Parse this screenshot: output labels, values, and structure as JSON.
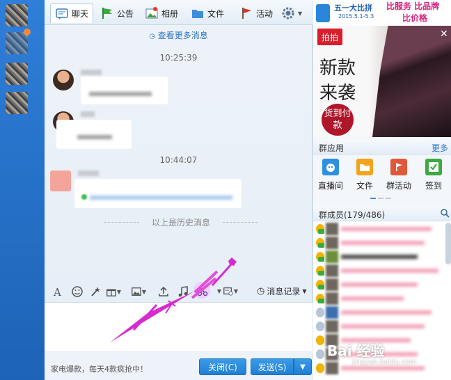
{
  "tabs": [
    {
      "label": "聊天",
      "icon": "chat-icon",
      "active": true
    },
    {
      "label": "公告",
      "icon": "flag-icon"
    },
    {
      "label": "相册",
      "icon": "photo-icon"
    },
    {
      "label": "文件",
      "icon": "folder-icon"
    },
    {
      "label": "活动",
      "icon": "red-flag-icon"
    }
  ],
  "chat": {
    "more_messages": "查看更多消息",
    "times": [
      "10:25:39",
      "10:44:07"
    ],
    "history_marker": "以上是历史消息"
  },
  "toolbar": {
    "message_log": "消息记录"
  },
  "bottom": {
    "ad_text": "家电爆款，每天4款疯抢中！",
    "close_label": "关闭(C)",
    "send_label": "发送(S)"
  },
  "banner": {
    "line1": "五一大比拼",
    "line2": "2015.5.1-5.3",
    "line3": "比服务 比品牌",
    "line4": "比价格"
  },
  "ad": {
    "tag": "拍拍",
    "headline1": "新款",
    "headline2": "来袭",
    "badge": "货到付款"
  },
  "group_apps": {
    "title": "群应用",
    "more": "更多",
    "items": [
      {
        "label": "直播间",
        "color": "#2f8fe0"
      },
      {
        "label": "文件",
        "color": "#f2a41c"
      },
      {
        "label": "群活动",
        "color": "#e0583a"
      },
      {
        "label": "签到",
        "color": "#3bab3f"
      }
    ]
  },
  "members": {
    "title": "群成员(179/486)"
  },
  "watermark": {
    "brand": "Bai 经验",
    "url": "jingyan.baidu.com"
  },
  "colors": {
    "accent": "#1f7fd3",
    "link": "#2d74c4",
    "annotation_arrow": "#d82ad1"
  }
}
